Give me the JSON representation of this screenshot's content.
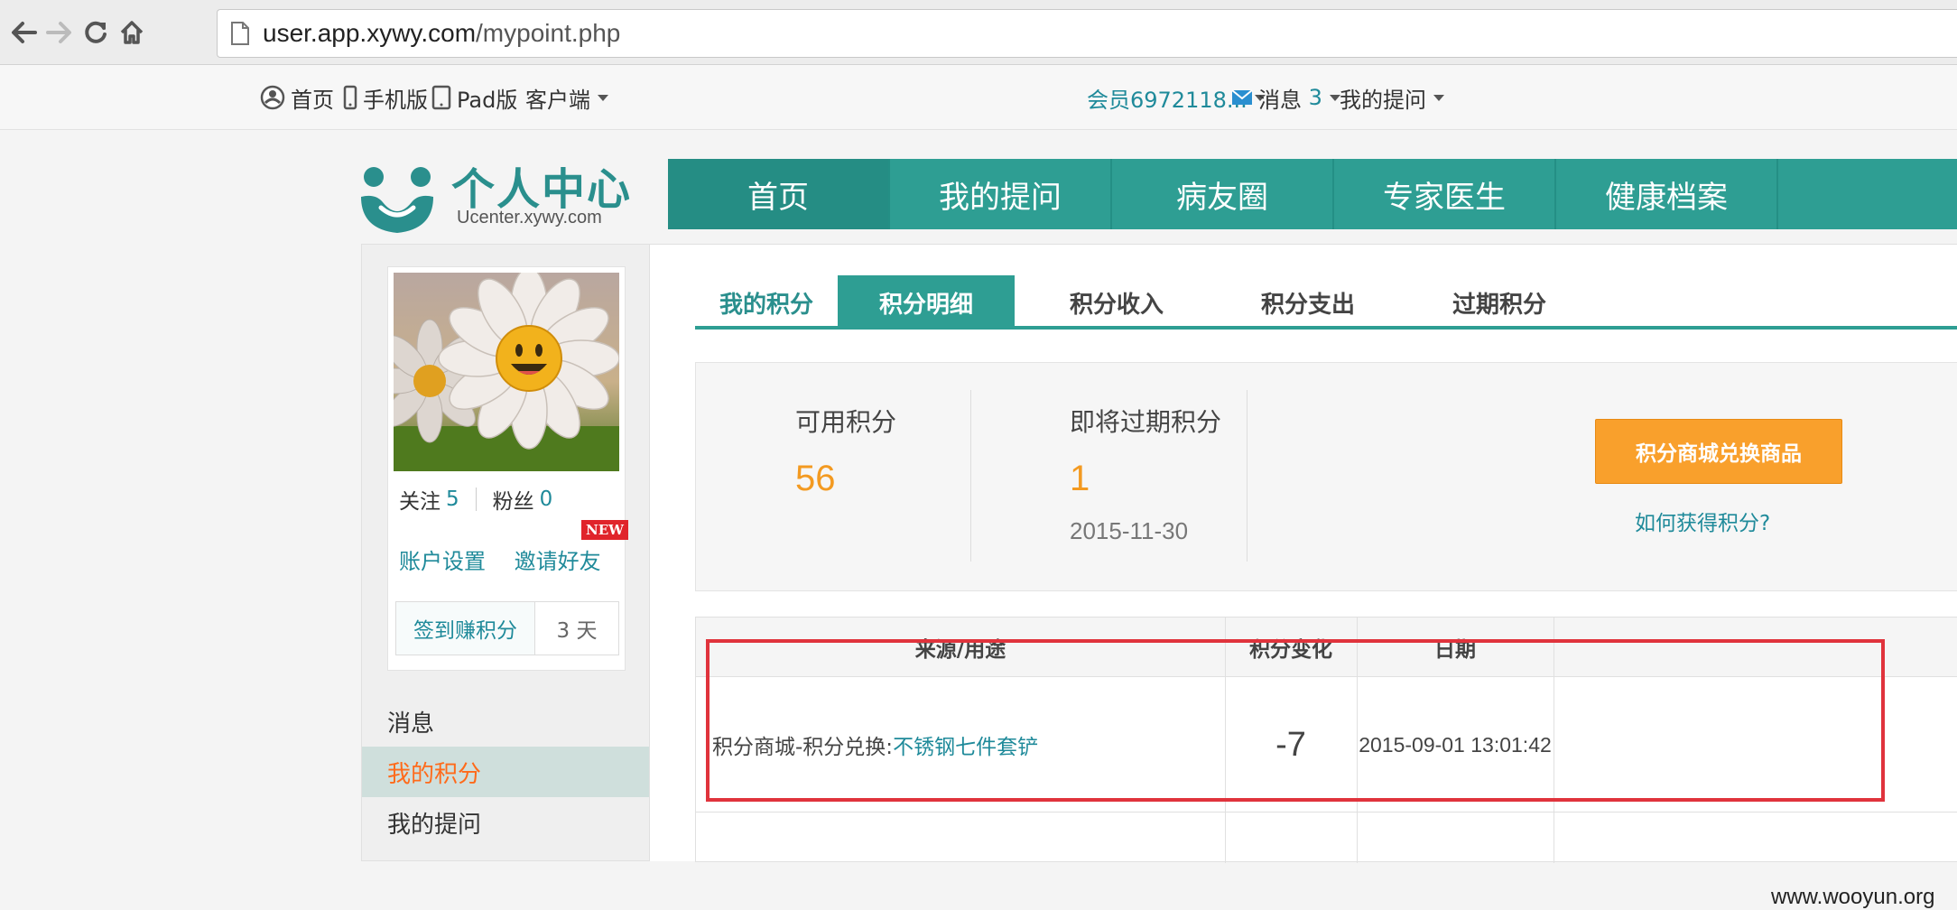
{
  "browser": {
    "url_host": "user.app.xywy.com",
    "url_path": "/mypoint.php"
  },
  "topbar": {
    "home": "首页",
    "mobile": "手机版",
    "pad": "Pad版",
    "client": "客户端",
    "member": "会员6972118...",
    "messages_label": "消息",
    "messages_count": "3",
    "my_questions": "我的提问"
  },
  "logo": {
    "title": "个人中心",
    "subtitle": "Ucenter.xywy.com"
  },
  "mainnav": {
    "items": [
      "首页",
      "我的提问",
      "病友圈",
      "专家医生",
      "健康档案"
    ]
  },
  "profile": {
    "follow_label": "关注",
    "follow_count": "5",
    "fans_label": "粉丝",
    "fans_count": "0",
    "new_badge": "NEW",
    "account_settings": "账户设置",
    "invite_friends": "邀请好友",
    "signin_label": "签到赚积分",
    "signin_days": "3 天"
  },
  "sidemenu": {
    "items": [
      "消息",
      "我的积分",
      "我的提问"
    ]
  },
  "subtabs": {
    "items": [
      "我的积分",
      "积分明细",
      "积分收入",
      "积分支出",
      "过期积分"
    ]
  },
  "summary": {
    "available_label": "可用积分",
    "available_value": "56",
    "expiring_label": "即将过期积分",
    "expiring_value": "1",
    "expiring_date": "2015-11-30",
    "mall_button": "积分商城兑换商品",
    "how_link": "如何获得积分?"
  },
  "table": {
    "headers": [
      "来源/用途",
      "积分变化",
      "日期"
    ],
    "rows": [
      {
        "source_prefix": "积分商城-积分兑换:",
        "source_item": "不锈钢七件套铲",
        "change": "-7",
        "date": "2015-09-01 13:01:42"
      }
    ]
  },
  "watermark": "www.wooyun.org",
  "colors": {
    "teal": "#2e9e93",
    "orange": "#f39a21",
    "highlight": "#e0333c"
  }
}
